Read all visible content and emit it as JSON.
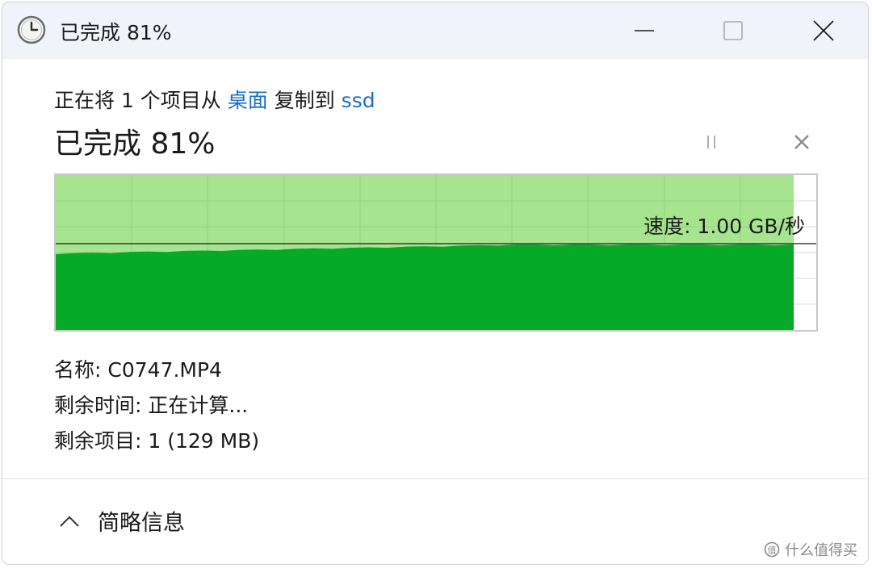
{
  "window": {
    "title": "已完成 81%",
    "icon": "clock-icon",
    "controls": {
      "minimize": "minimize-icon",
      "maximize": "maximize-icon",
      "close": "close-icon"
    }
  },
  "header": {
    "prefix": "正在将 1 个项目从 ",
    "source": "桌面",
    "middle": " 复制到 ",
    "destination": "ssd"
  },
  "status": "已完成 81%",
  "progress": {
    "percent": 81
  },
  "controls": {
    "pause": "pause-icon",
    "cancel": "cancel-icon"
  },
  "graph": {
    "speed_label": "速度: 1.00 GB/秒",
    "fill_color": "#06a928",
    "bg_fill_color": "#a6e48f",
    "grid_color": "#8fd87a"
  },
  "details": {
    "name_label": "名称:",
    "name_value": "C0747.MP4",
    "time_label": "剩余时间:",
    "time_value": "正在计算...",
    "items_label": "剩余项目:",
    "items_value": "1 (129 MB)"
  },
  "footer": {
    "toggle_label": "简略信息",
    "toggle_icon": "chevron-up-icon"
  },
  "watermark": "什么值得买"
}
